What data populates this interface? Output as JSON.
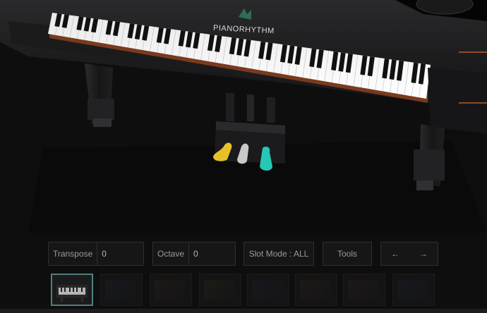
{
  "piano": {
    "brand": "PIANORHYTHM"
  },
  "toolbar": {
    "transpose_label": "Transpose",
    "transpose_value": "0",
    "octave_label": "Octave",
    "octave_value": "0",
    "slot_mode_label": "Slot Mode : ALL",
    "tools_label": "Tools",
    "prev_arrow": "←",
    "next_arrow": "→"
  },
  "instrument_slots": {
    "count": 8,
    "active_index": 0
  },
  "colors": {
    "pedal_left": "#e8c12a",
    "pedal_center": "#c9c9c9",
    "pedal_right": "#27c7b6",
    "active_slot_border": "#4f7f7f"
  }
}
